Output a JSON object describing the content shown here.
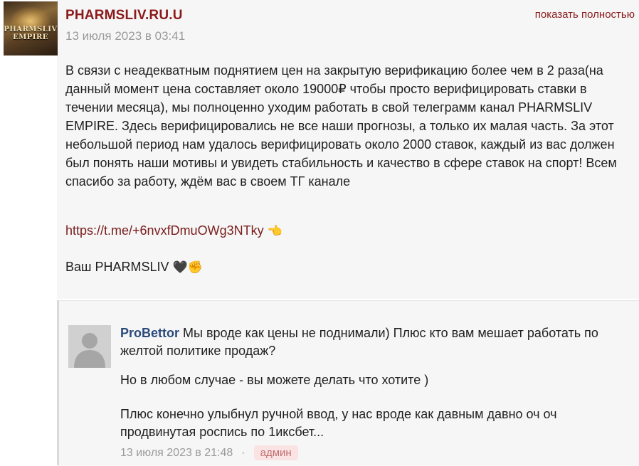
{
  "post": {
    "author": "PHARMSLIV.RU.U",
    "date": "13 июля 2023 в 03:41",
    "show_full": "показать полностью",
    "avatar_text": "PHARMSLIV EMPIRE",
    "paragraphs": [
      "В связи с неадекватным поднятием цен на закрытую верификацию более чем в 2 раза(на данный момент цена составляет около 19000₽ чтобы просто верифицировать ставки в течении месяца), мы полноценно уходим работать в свой телеграмм канал PHARMSLIV EMPIRE. Здесь верифицировались не все наши прогнозы, а только их малая часть. За этот небольшой период нам удалось верифицировать около 2000 ставок, каждый из вас должен был понять наши мотивы и увидеть стабильность и качество в сфере ставок на спорт! Всем спасибо за работу, ждём вас в своем ТГ канале"
    ],
    "link": "https://t.me/+6nvxfDmuOWg3NTky",
    "link_emoji": "👈",
    "signature": "Ваш PHARMSLIV",
    "signature_emoji": "🖤✊"
  },
  "reply": {
    "author": "ProBettor",
    "text1": "Мы вроде как цены не поднимали) Плюс кто вам мешает работать по желтой политике продаж?",
    "text2": "Но в любом случае - вы можете делать что хотите )",
    "text3": "Плюс конечно улыбнул ручной ввод, у нас вроде как давным давно оч оч продвинутая роспись по 1иксбет...",
    "date": "13 июля 2023 в 21:48",
    "separator": "·",
    "badge": "админ"
  },
  "colors": {
    "author": "#8b1a1a",
    "reply_author": "#2b4a7c",
    "muted": "#9a9a9a",
    "badge_bg": "#fbe3e3",
    "badge_text": "#c07070"
  }
}
